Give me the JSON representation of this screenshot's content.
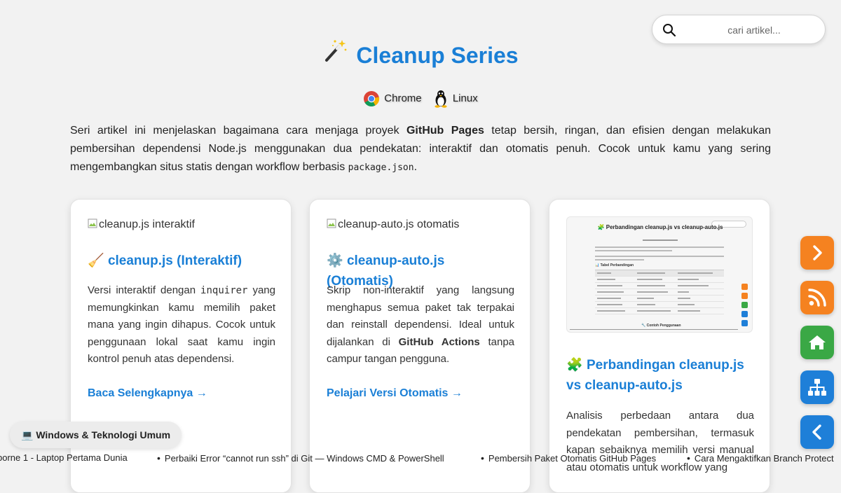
{
  "search": {
    "placeholder": "cari artikel..."
  },
  "header": {
    "icon": "magic-wand-icon",
    "title": "Cleanup Series",
    "platforms": [
      {
        "icon": "chrome-icon",
        "label": "Chrome"
      },
      {
        "icon": "linux-tux-icon",
        "label": "Linux"
      }
    ]
  },
  "intro": {
    "part1": "Seri artikel ini menjelaskan bagaimana cara menjaga proyek ",
    "bold1": "GitHub Pages",
    "part2": " tetap bersih, ringan, dan efisien dengan melakukan pembersihan dependensi Node.js menggunakan dua pendekatan: interaktif dan otomatis penuh. Cocok untuk kamu yang sering mengembangkan situs statis dengan workflow berbasis ",
    "code": "package.json",
    "part3": "."
  },
  "cards": [
    {
      "image_alt": "cleanup.js interaktif",
      "emoji": "🧹",
      "title": "cleanup.js (Interaktif)",
      "desc_a": "Versi interaktif dengan ",
      "desc_code": "inquirer",
      "desc_b": " yang memungkinkan kamu memilih paket mana yang ingin dihapus. Cocok untuk penggunaan lokal saat kamu ingin kontrol penuh atas dependensi.",
      "link": "Baca Selengkapnya →"
    },
    {
      "image_alt": "cleanup-auto.js otomatis",
      "emoji": "⚙️",
      "title": "cleanup-auto.js (Otomatis)",
      "desc_a": "Skrip non-interaktif yang langsung menghapus semua paket tak terpakai dan reinstall dependensi. Ideal untuk dijalankan di ",
      "desc_bold": "GitHub Actions",
      "desc_b": " tanpa campur tangan pengguna.",
      "link": "Pelajari Versi Otomatis →"
    },
    {
      "thumb_title": "🧩 Perbandingan cleanup.js vs cleanup-auto.js",
      "thumb_table_title": "📊 Tabel Perbandingan",
      "thumb_usage_title": "🔧 Contoh Penggunaan",
      "emoji": "🧩",
      "title": "Perbandingan cleanup.js vs cleanup-auto.js",
      "desc": "Analisis perbedaan antara dua pendekatan pembersihan, termasuk kapan sebaiknya memilih versi manual atau otomatis untuk workflow yang"
    }
  ],
  "fabs": [
    {
      "icon": "chevron-right-icon",
      "color": "#f58220"
    },
    {
      "icon": "rss-icon",
      "color": "#f58220"
    },
    {
      "icon": "home-icon",
      "color": "#3aa845"
    },
    {
      "icon": "sitemap-icon",
      "color": "#1e7fd8"
    },
    {
      "icon": "chevron-left-icon",
      "color": "#1e7fd8"
    }
  ],
  "category": {
    "icon": "laptop-icon",
    "emoji": "💻",
    "label": "Windows & Teknologi Umum"
  },
  "ticker": [
    "borne 1 - Laptop Pertama Dunia",
    "Perbaiki Error “cannot run ssh” di Git — Windows CMD & PowerShell",
    "Pembersih Paket Otomatis GitHub Pages",
    "Cara Mengaktifkan Branch Protect"
  ],
  "colors": {
    "accent": "#1a7fd6",
    "orange": "#f58220",
    "green": "#3aa845",
    "blue": "#1e7fd8"
  }
}
